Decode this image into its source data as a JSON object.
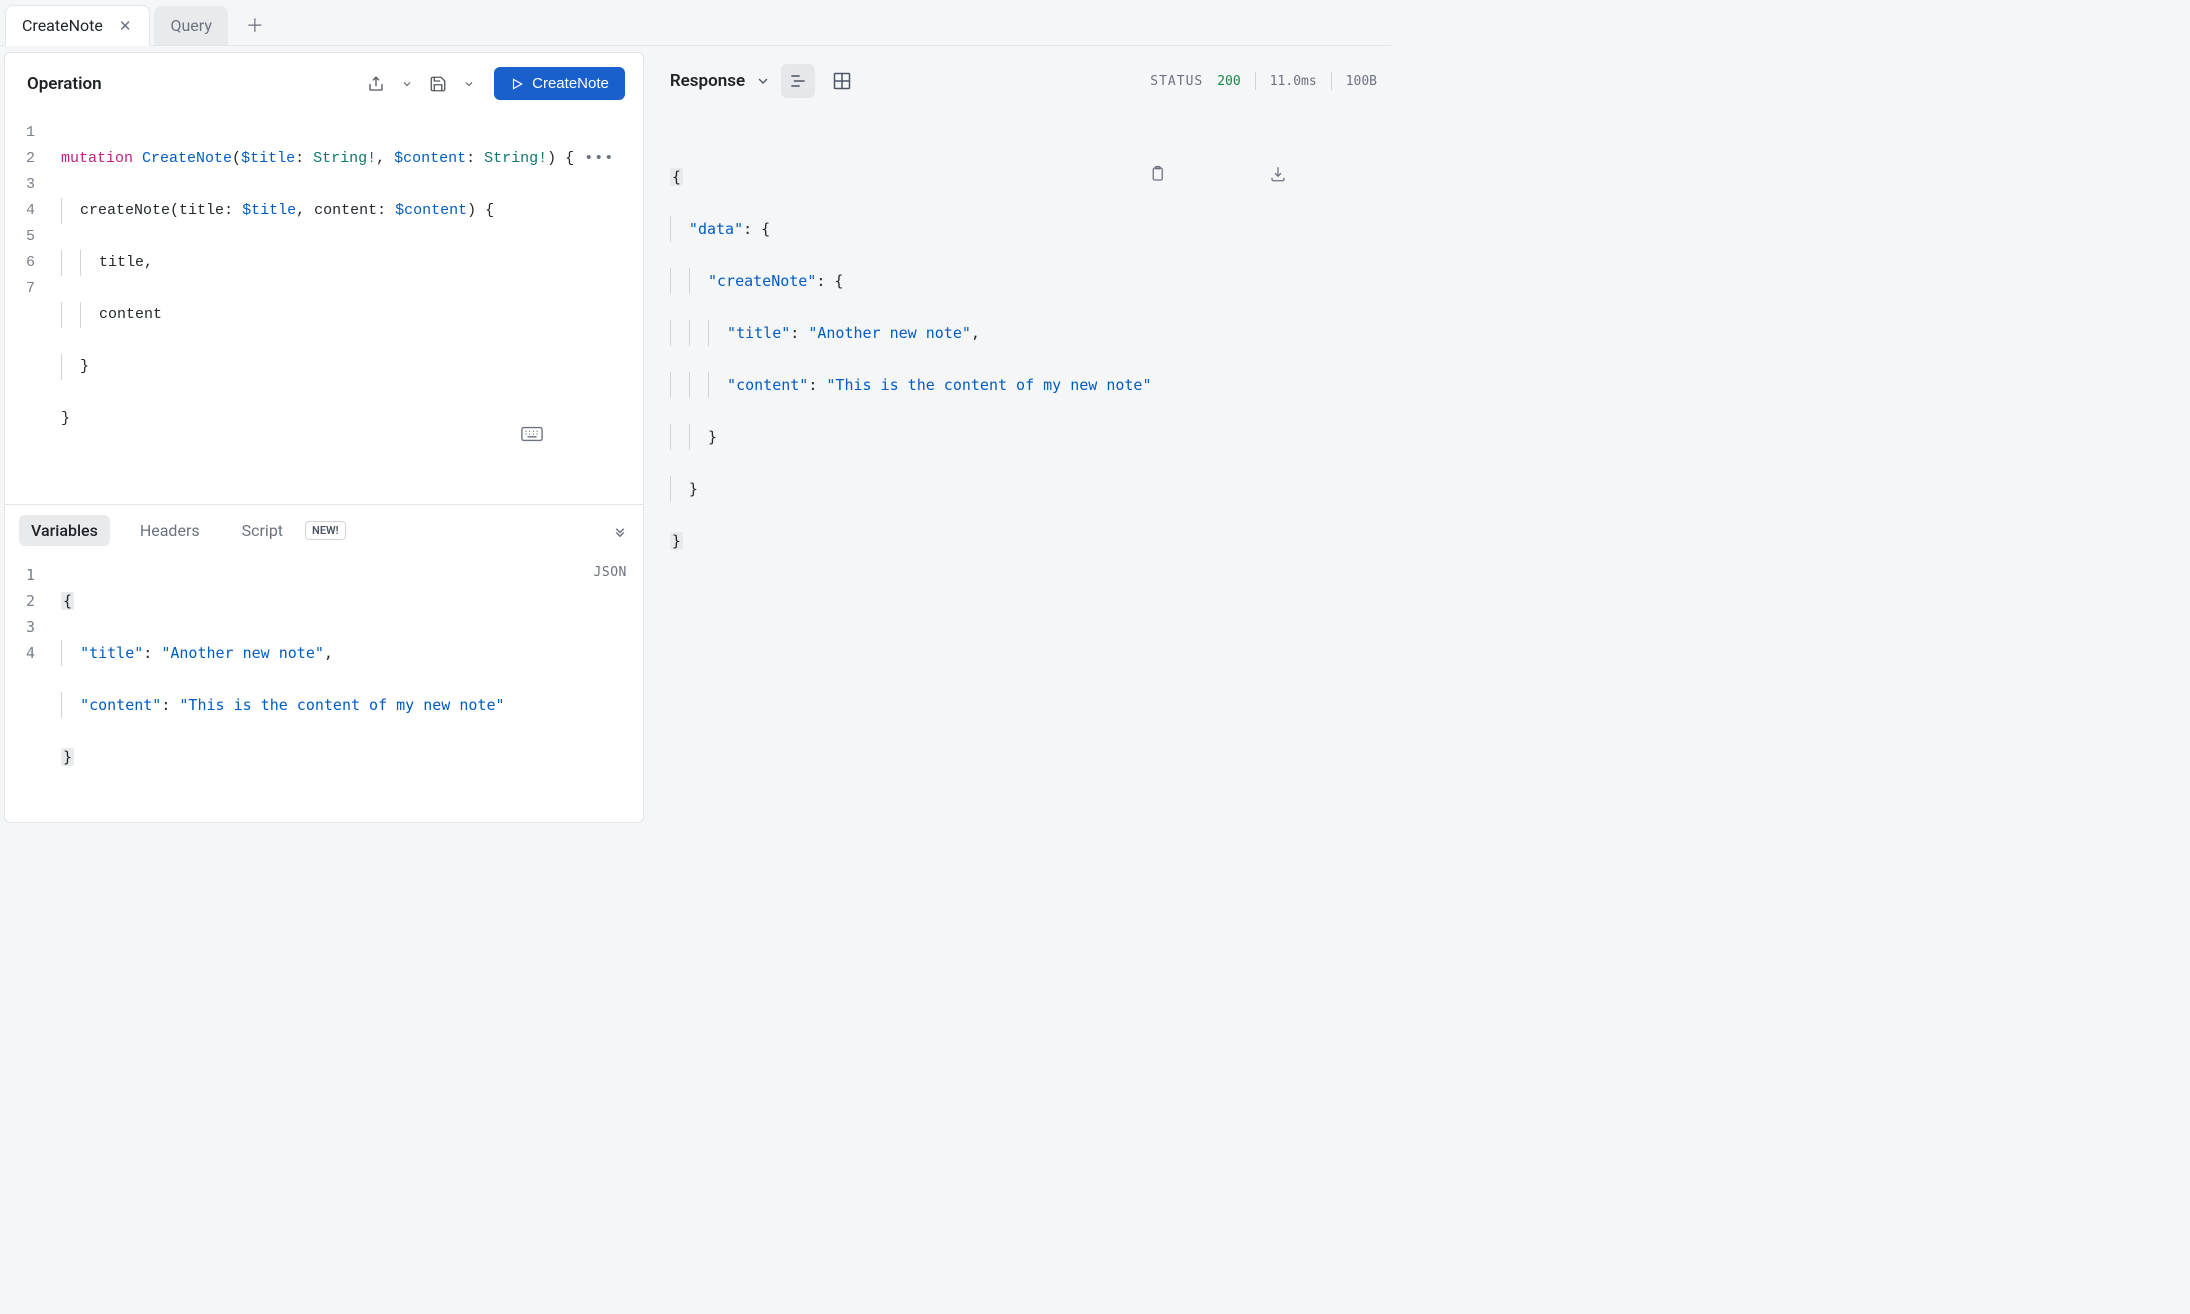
{
  "tabs": [
    {
      "label": "CreateNote",
      "active": true
    },
    {
      "label": "Query",
      "active": false
    }
  ],
  "operation": {
    "title": "Operation",
    "run_label": "CreateNote",
    "code": {
      "lines": [
        "1",
        "2",
        "3",
        "4",
        "5",
        "6",
        "7"
      ],
      "l1_kw": "mutation",
      "l1_name": "CreateNote",
      "l1_var1": "$title",
      "l1_type1": "String!",
      "l1_var2": "$content",
      "l1_type2": "String!",
      "l2_fn": "createNote",
      "l2_arg1": "title",
      "l2_val1": "$title",
      "l2_arg2": "content",
      "l2_val2": "$content",
      "l3": "title",
      "l4": "content"
    }
  },
  "bottom": {
    "tabs": {
      "variables": "Variables",
      "headers": "Headers",
      "script": "Script",
      "new_badge": "NEW!"
    },
    "json_label": "JSON",
    "vars": {
      "lines": [
        "1",
        "2",
        "3",
        "4"
      ],
      "k1": "\"title\"",
      "v1": "\"Another new note\"",
      "k2": "\"content\"",
      "v2": "\"This is the content of my new note\""
    }
  },
  "response": {
    "title": "Response",
    "status_label": "STATUS",
    "status_code": "200",
    "time": "11.0ms",
    "size": "100B",
    "body": {
      "k_data": "\"data\"",
      "k_createNote": "\"createNote\"",
      "k_title": "\"title\"",
      "v_title": "\"Another new note\"",
      "k_content": "\"content\"",
      "v_content": "\"This is the content of my new note\""
    }
  }
}
